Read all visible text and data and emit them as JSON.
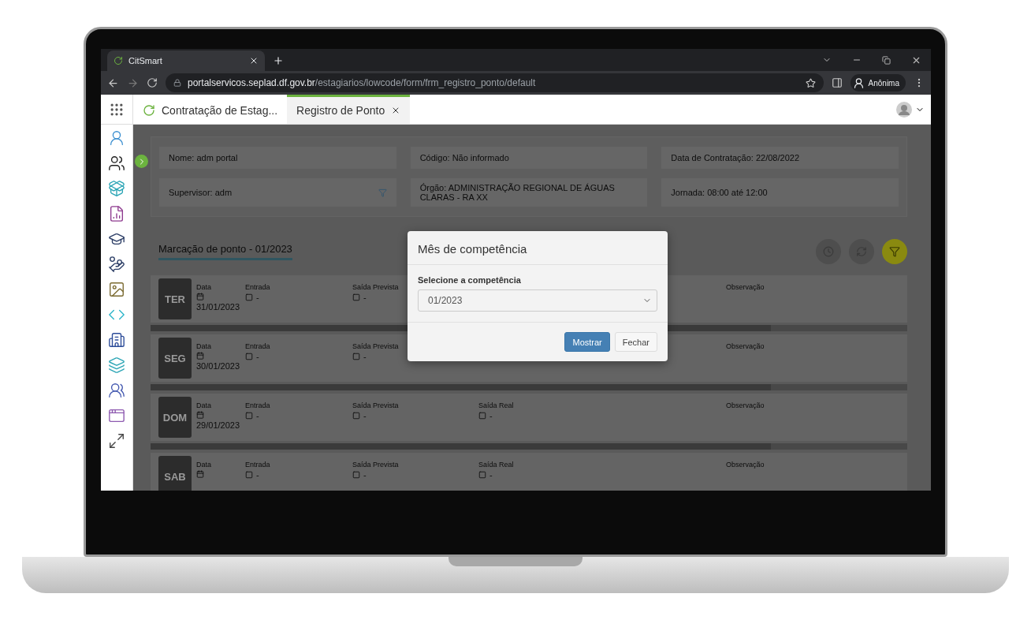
{
  "browser": {
    "tab_title": "CitSmart",
    "url_host": "portalservicos.seplad.df.gov.br",
    "url_path": "/estagiarios/lowcode/form/frm_registro_ponto/default",
    "profile": "Anônima"
  },
  "app_tabs": [
    {
      "label": "Contratação de Estag...",
      "selected": false
    },
    {
      "label": "Registro de Ponto",
      "selected": true
    }
  ],
  "info": [
    "Nome: adm portal",
    "Código: Não informado",
    "Data de Contratação: 22/08/2022",
    "Supervisor: adm",
    "Órgão: ADMINISTRAÇÃO REGIONAL DE ÁGUAS CLARAS - RA XX",
    "Jornada: 08:00 até 12:00"
  ],
  "section_title": "Marcação de ponto - 01/2023",
  "days": [
    {
      "day": "TER",
      "fields": [
        {
          "kind": "data",
          "label": "Data",
          "value": "31/01/2023"
        },
        {
          "kind": "entrada",
          "label": "Entrada",
          "value": "-"
        },
        {
          "kind": "saida_prevista",
          "label": "Saída Prevista",
          "value": "-"
        },
        {
          "kind": "observacao",
          "label": "Observação"
        }
      ]
    },
    {
      "day": "SEG",
      "fields": [
        {
          "kind": "data",
          "label": "Data",
          "value": "30/01/2023"
        },
        {
          "kind": "entrada",
          "label": "Entrada",
          "value": "-"
        },
        {
          "kind": "saida_prevista",
          "label": "Saída Prevista",
          "value": "-"
        },
        {
          "kind": "observacao",
          "label": "Observação"
        }
      ]
    },
    {
      "day": "DOM",
      "fields": [
        {
          "kind": "data",
          "label": "Data",
          "value": "29/01/2023"
        },
        {
          "kind": "entrada",
          "label": "Entrada",
          "value": "-"
        },
        {
          "kind": "saida_prevista",
          "label": "Saída Prevista",
          "value": "-"
        },
        {
          "kind": "saida_real",
          "label": "Saída Real",
          "value": "-"
        },
        {
          "kind": "observacao",
          "label": "Observação"
        }
      ]
    },
    {
      "day": "SAB",
      "fields": [
        {
          "kind": "data",
          "label": "Data"
        },
        {
          "kind": "entrada",
          "label": "Entrada",
          "value": "-"
        },
        {
          "kind": "saida_prevista",
          "label": "Saída Prevista",
          "value": "-"
        },
        {
          "kind": "saida_real",
          "label": "Saída Real",
          "value": "-"
        },
        {
          "kind": "observacao",
          "label": "Observação"
        }
      ]
    }
  ],
  "dialog": {
    "title": "Mês de competência",
    "field_label": "Selecione a competência",
    "value": "01/2023",
    "buttons": [
      {
        "label": "Mostrar",
        "kind": "primary"
      },
      {
        "label": "Fechar",
        "kind": "default"
      }
    ]
  }
}
